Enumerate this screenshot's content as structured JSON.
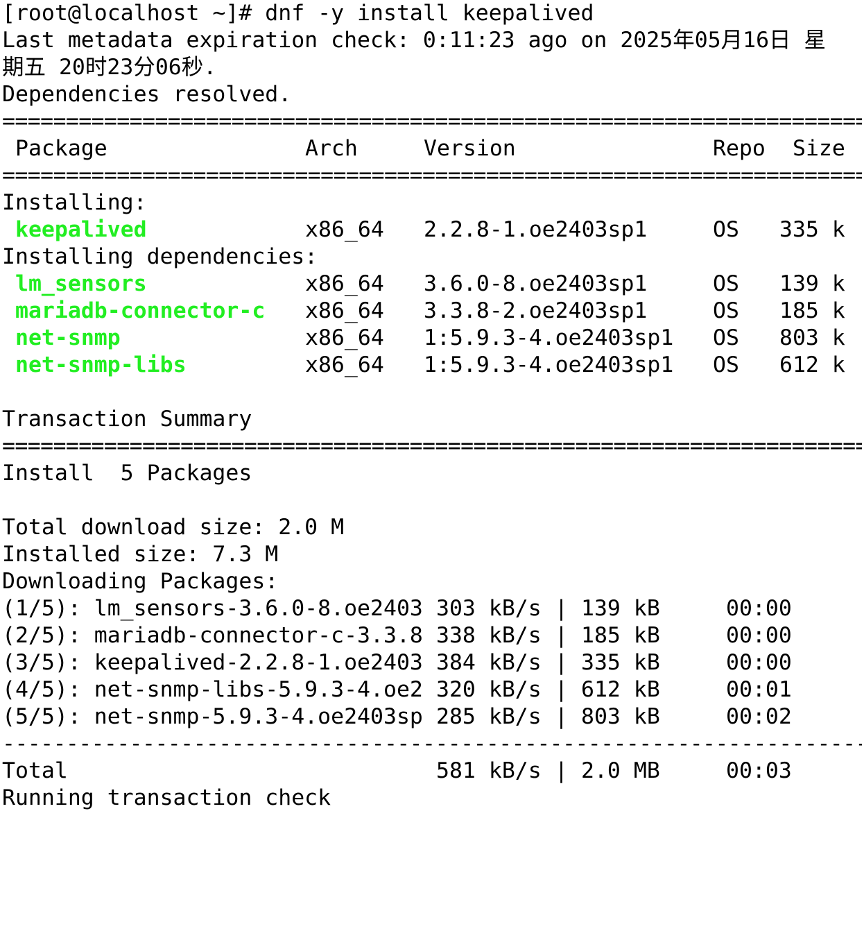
{
  "command": {
    "prompt": "[root@localhost ~]# ",
    "text": "dnf -y install keepalived"
  },
  "metadata_line_1": "Last metadata expiration check: 0:11:23 ago on 2025年05月16日 星",
  "metadata_line_2": "期五 20时23分06秒.",
  "deps_resolved": "Dependencies resolved.",
  "rule_double": "====================================================================",
  "rule_single": "--------------------------------------------------------------------",
  "table": {
    "headers": {
      "package": "Package",
      "arch": "Arch",
      "version": "Version",
      "repo": "Repo",
      "size": "Size"
    },
    "installing_label": "Installing:",
    "installing": [
      {
        "name": "keepalived",
        "arch": "x86_64",
        "version": "2.2.8-1.oe2403sp1",
        "repo": "OS",
        "size": "335 k"
      }
    ],
    "deps_label": "Installing dependencies:",
    "dependencies": [
      {
        "name": "lm_sensors",
        "arch": "x86_64",
        "version": "3.6.0-8.oe2403sp1",
        "repo": "OS",
        "size": "139 k"
      },
      {
        "name": "mariadb-connector-c",
        "arch": "x86_64",
        "version": "3.3.8-2.oe2403sp1",
        "repo": "OS",
        "size": "185 k"
      },
      {
        "name": "net-snmp",
        "arch": "x86_64",
        "version": "1:5.9.3-4.oe2403sp1",
        "repo": "OS",
        "size": "803 k"
      },
      {
        "name": "net-snmp-libs",
        "arch": "x86_64",
        "version": "1:5.9.3-4.oe2403sp1",
        "repo": "OS",
        "size": "612 k"
      }
    ]
  },
  "summary": {
    "title": "Transaction Summary",
    "install_line": "Install  5 Packages",
    "total_download": "Total download size: 2.0 M",
    "installed_size": "Installed size: 7.3 M",
    "downloading": "Downloading Packages:"
  },
  "downloads": [
    {
      "name": "(1/5): lm_sensors-3.6.0-8.oe2403",
      "rate": "303 kB/s",
      "sep": "|",
      "size": "139 kB",
      "time": "00:00"
    },
    {
      "name": "(2/5): mariadb-connector-c-3.3.8",
      "rate": "338 kB/s",
      "sep": "|",
      "size": "185 kB",
      "time": "00:00"
    },
    {
      "name": "(3/5): keepalived-2.2.8-1.oe2403",
      "rate": "384 kB/s",
      "sep": "|",
      "size": "335 kB",
      "time": "00:00"
    },
    {
      "name": "(4/5): net-snmp-libs-5.9.3-4.oe2",
      "rate": "320 kB/s",
      "sep": "|",
      "size": "612 kB",
      "time": "00:01"
    },
    {
      "name": "(5/5): net-snmp-5.9.3-4.oe2403sp",
      "rate": "285 kB/s",
      "sep": "|",
      "size": "803 kB",
      "time": "00:02"
    }
  ],
  "total": {
    "label": "Total",
    "rate": "581 kB/s",
    "sep": "|",
    "size": "2.0 MB",
    "time": "00:03"
  },
  "last_line": "Running transaction check"
}
